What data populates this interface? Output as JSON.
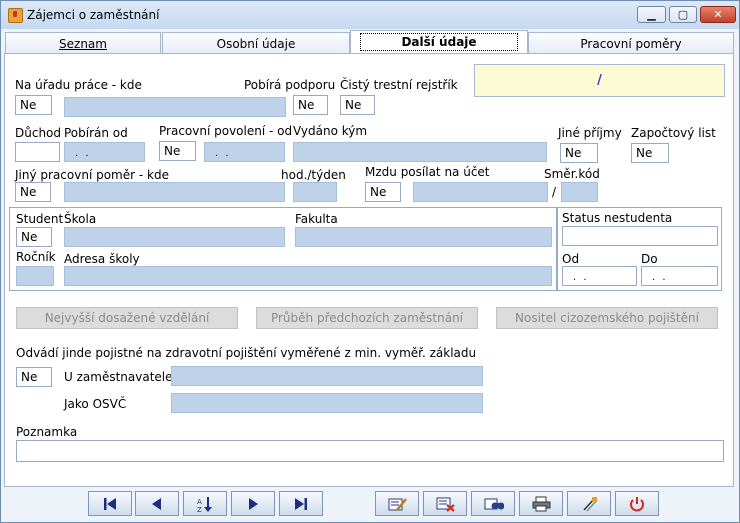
{
  "window": {
    "title": "Zájemci o zaměstnání"
  },
  "tabs": [
    "Seznam",
    "Osobní údaje",
    "Další údaje",
    "Pracovní poměry"
  ],
  "info_box": "/",
  "fields": {
    "na_uradu_label": "Na úřadu práce - kde",
    "na_uradu_value": "Ne",
    "pobira_podporu_label": "Pobírá podporu",
    "pobira_podporu_value": "Ne",
    "rejstrik_label": "Čistý trestní rejstřík",
    "rejstrik_value": "Ne",
    "duchod_label": "Důchod",
    "pobiran_od_label": "Pobírán od",
    "date_placeholder": ". .",
    "povoleni_label": "Pracovní povolení - od",
    "povoleni_value": "Ne",
    "vydano_label": "Vydáno kým",
    "jine_prijmy_label": "Jiné příjmy",
    "jine_prijmy_value": "Ne",
    "zapoctovy_label": "Započtový list",
    "zapoctovy_value": "Ne",
    "jiny_pomer_label": "Jiný pracovní poměr - kde",
    "jiny_pomer_value": "Ne",
    "hod_tyden_label": "hod./týden",
    "mzdu_label": "Mzdu posílat na účet",
    "mzdu_value": "Ne",
    "smer_kod_label": "Směr.kód",
    "slash": "/",
    "student_label": "Student",
    "student_value": "Ne",
    "skola_label": "Škola",
    "fakulta_label": "Fakulta",
    "rocnik_label": "Ročník",
    "adresa_label": "Adresa školy",
    "status_label": "Status nestudenta",
    "od_label": "Od",
    "do_label": "Do",
    "odvadi_label": "Odvádí jinde pojistné na zdravotní pojištění vyměřené z min. vyměř. základu",
    "odvadi_value": "Ne",
    "u_zamestnavatele_label": "U zaměstnavatele",
    "jako_osvc_label": "Jako OSVČ",
    "poznamka_label": "Poznamka"
  },
  "buttons": {
    "vzdelani": "Nejvyšší dosažené vzdělání",
    "prubeh": "Průběh předchozích zaměstnání",
    "nositel": "Nositel cizozemského pojištění"
  },
  "toolbar_icons": [
    "first-record-icon",
    "previous-record-icon",
    "sort-az-icon",
    "next-record-icon",
    "last-record-icon",
    "edit-icon",
    "delete-icon",
    "search-icon",
    "print-icon",
    "attach-icon",
    "power-icon"
  ]
}
